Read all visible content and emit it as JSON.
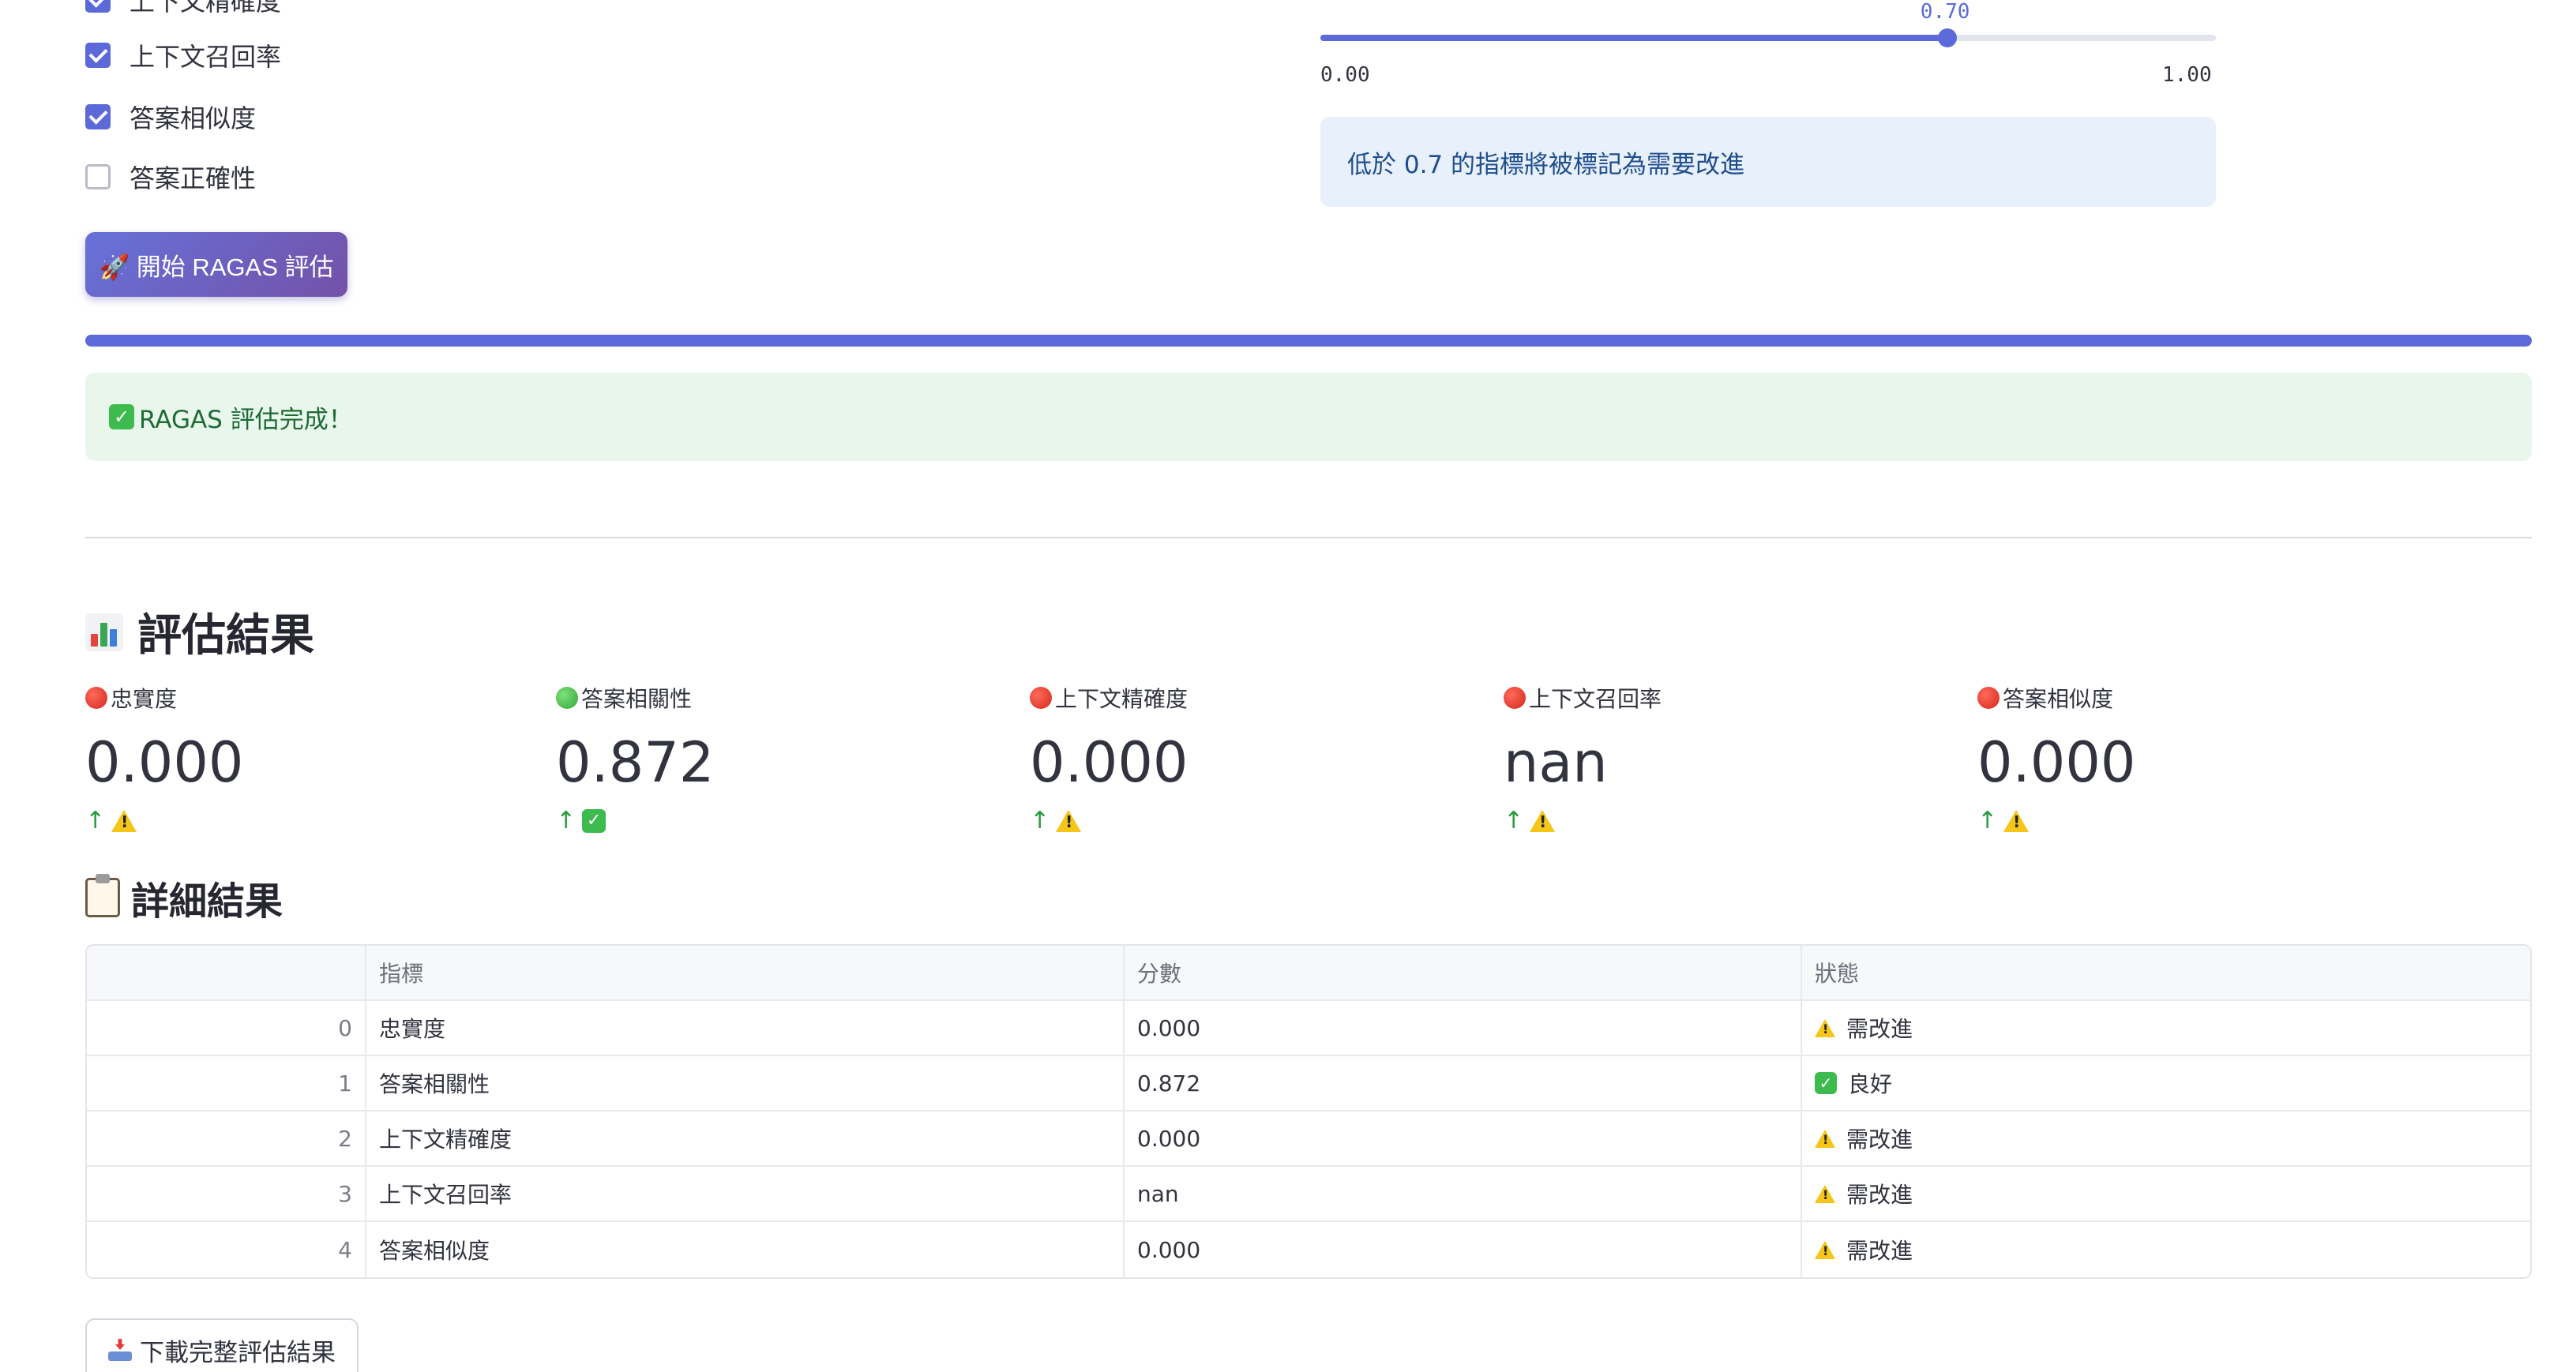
{
  "metrics_options": {
    "partial_label": "上下文精確度",
    "items": [
      {
        "label": "上下文召回率",
        "checked": true
      },
      {
        "label": "答案相似度",
        "checked": true
      },
      {
        "label": "答案正確性",
        "checked": false
      }
    ]
  },
  "start_button": {
    "label": "🚀 開始 RAGAS 評估"
  },
  "threshold": {
    "value": 0.7,
    "value_label": "0.70",
    "min_label": "0.00",
    "max_label": "1.00",
    "info": "低於 0.7 的指標將被標記為需要改進"
  },
  "progress": {
    "value": 1.0
  },
  "success_message": "RAGAS 評估完成！",
  "results_section": {
    "title": "評估結果"
  },
  "metrics": [
    {
      "label": "忠實度",
      "value": "0.000",
      "dot": "red",
      "status": "warn"
    },
    {
      "label": "答案相關性",
      "value": "0.872",
      "dot": "green",
      "status": "ok"
    },
    {
      "label": "上下文精確度",
      "value": "0.000",
      "dot": "red",
      "status": "warn"
    },
    {
      "label": "上下文召回率",
      "value": "nan",
      "dot": "red",
      "status": "warn"
    },
    {
      "label": "答案相似度",
      "value": "0.000",
      "dot": "red",
      "status": "warn"
    }
  ],
  "details_section": {
    "title": "詳細結果"
  },
  "table": {
    "headers": [
      "",
      "指標",
      "分數",
      "狀態"
    ],
    "rows": [
      {
        "index": "0",
        "metric": "忠實度",
        "score": "0.000",
        "status": "需改進",
        "icon": "warn"
      },
      {
        "index": "1",
        "metric": "答案相關性",
        "score": "0.872",
        "status": "良好",
        "icon": "ok"
      },
      {
        "index": "2",
        "metric": "上下文精確度",
        "score": "0.000",
        "status": "需改進",
        "icon": "warn"
      },
      {
        "index": "3",
        "metric": "上下文召回率",
        "score": "nan",
        "status": "需改進",
        "icon": "warn"
      },
      {
        "index": "4",
        "metric": "答案相似度",
        "score": "0.000",
        "status": "需改進",
        "icon": "warn"
      }
    ]
  },
  "download_button": {
    "label": "下載完整評估結果"
  },
  "colors": {
    "accent": "#5b6ad8",
    "success_bg": "#e9f6ec",
    "info_bg": "#e8f0fb"
  }
}
